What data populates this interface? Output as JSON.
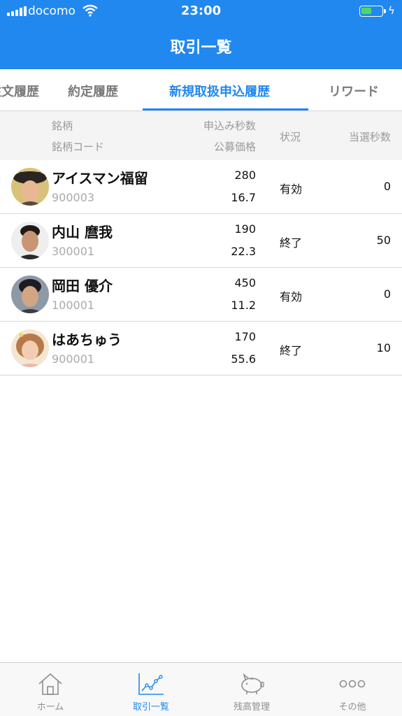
{
  "status_bar": {
    "carrier": "docomo",
    "time": "23:00",
    "signal_icon": "signal-bars-icon",
    "wifi_icon": "wifi-icon",
    "battery_icon": "battery-charging-icon"
  },
  "nav": {
    "title": "取引一覧"
  },
  "tabs": [
    {
      "label": "注文履歴",
      "partial": "文履歴"
    },
    {
      "label": "約定履歴"
    },
    {
      "label": "新規取扱申込履歴",
      "active": true
    },
    {
      "label": "リワード"
    }
  ],
  "header": {
    "col_name": "銘柄",
    "col_code": "銘柄コード",
    "col_applied": "申込み秒数",
    "col_price": "公募価格",
    "col_status": "状況",
    "col_won": "当選秒数"
  },
  "rows": [
    {
      "name": "アイスマン福留",
      "code": "900003",
      "applied": "280",
      "price": "16.7",
      "status": "有効",
      "won": "0"
    },
    {
      "name": "内山 麿我",
      "code": "300001",
      "applied": "190",
      "price": "22.3",
      "status": "終了",
      "won": "50"
    },
    {
      "name": "岡田 優介",
      "code": "100001",
      "applied": "450",
      "price": "11.2",
      "status": "有効",
      "won": "0"
    },
    {
      "name": "はあちゅう",
      "code": "900001",
      "applied": "170",
      "price": "55.6",
      "status": "終了",
      "won": "10"
    }
  ],
  "tab_bar": [
    {
      "label": "ホーム",
      "icon": "home-icon"
    },
    {
      "label": "取引一覧",
      "icon": "chart-line-icon",
      "active": true
    },
    {
      "label": "残高管理",
      "icon": "piggy-bank-icon"
    },
    {
      "label": "その他",
      "icon": "more-dots-icon"
    }
  ],
  "colors": {
    "accent": "#2188ef",
    "battery": "#4cd964"
  }
}
